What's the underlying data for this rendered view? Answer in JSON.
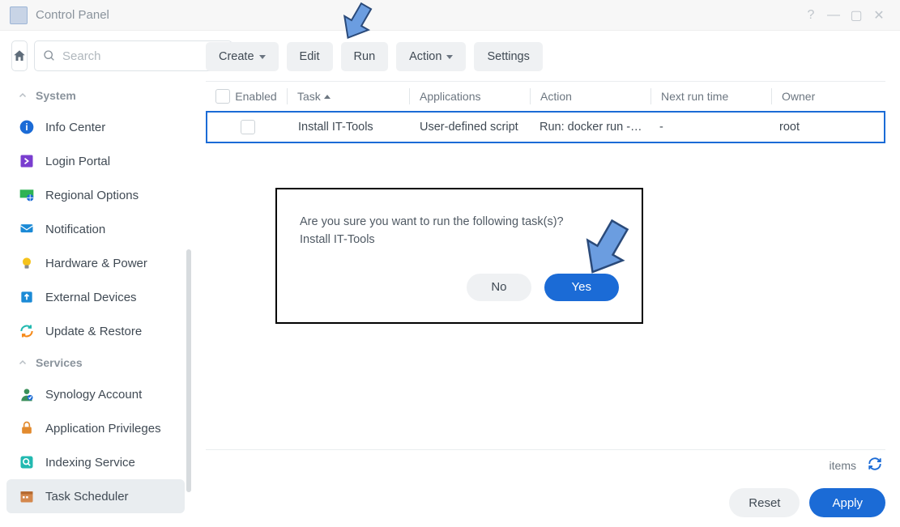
{
  "window": {
    "title": "Control Panel"
  },
  "search": {
    "placeholder": "Search"
  },
  "sidebar": {
    "sections": [
      {
        "label": "System",
        "items": [
          {
            "label": "Info Center",
            "icon": "info-icon",
            "color": "#1b6bd6"
          },
          {
            "label": "Login Portal",
            "icon": "portal-icon",
            "color": "#7a3ecf"
          },
          {
            "label": "Regional Options",
            "icon": "globe-icon",
            "color": "#2eb354"
          },
          {
            "label": "Notification",
            "icon": "notification-icon",
            "color": "#1b8ad6"
          },
          {
            "label": "Hardware & Power",
            "icon": "bulb-icon",
            "color": "#f5b21a"
          },
          {
            "label": "External Devices",
            "icon": "external-icon",
            "color": "#1b8ad6"
          },
          {
            "label": "Update & Restore",
            "icon": "update-icon",
            "color": "#22b9b0"
          }
        ]
      },
      {
        "label": "Services",
        "items": [
          {
            "label": "Synology Account",
            "icon": "account-icon",
            "color": "#3a8f5a"
          },
          {
            "label": "Application Privileges",
            "icon": "lock-icon",
            "color": "#e28a2e"
          },
          {
            "label": "Indexing Service",
            "icon": "search-service-icon",
            "color": "#22b9b0"
          },
          {
            "label": "Task Scheduler",
            "icon": "calendar-icon",
            "color": "#d4884d",
            "active": true
          }
        ]
      }
    ]
  },
  "toolbar": {
    "create": "Create",
    "edit": "Edit",
    "run": "Run",
    "action": "Action",
    "settings": "Settings"
  },
  "table": {
    "columns": {
      "enabled": "Enabled",
      "task": "Task",
      "applications": "Applications",
      "action": "Action",
      "next_run": "Next run time",
      "owner": "Owner"
    },
    "rows": [
      {
        "enabled": false,
        "task": "Install IT-Tools",
        "applications": "User-defined script",
        "action": "Run: docker run -…",
        "next_run": "-",
        "owner": "root"
      }
    ],
    "footer_items": "items"
  },
  "footer": {
    "reset": "Reset",
    "apply": "Apply"
  },
  "dialog": {
    "message": "Are you sure you want to run the following task(s)?",
    "task_name": "Install IT-Tools",
    "no": "No",
    "yes": "Yes"
  }
}
